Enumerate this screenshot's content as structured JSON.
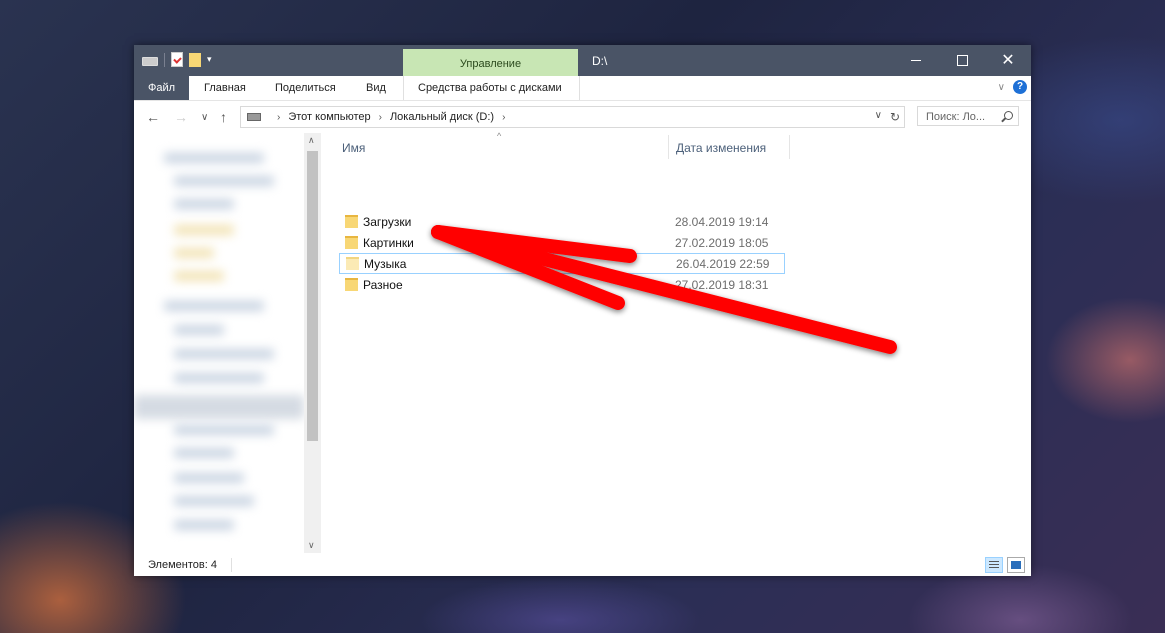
{
  "titlebar": {
    "manage_tab": "Управление",
    "path_title": "D:\\"
  },
  "ribbon": {
    "tabs": [
      {
        "label": "Файл"
      },
      {
        "label": "Главная"
      },
      {
        "label": "Поделиться"
      },
      {
        "label": "Вид"
      },
      {
        "label": "Средства работы с дисками"
      }
    ],
    "help_label": "?"
  },
  "address": {
    "crumbs": [
      "Этот компьютер",
      "Локальный диск (D:)"
    ],
    "search_placeholder": "Поиск: Ло..."
  },
  "columns": {
    "name": "Имя",
    "date": "Дата изменения"
  },
  "files": [
    {
      "name": "Загрузки",
      "date": "28.04.2019 19:14"
    },
    {
      "name": "Картинки",
      "date": "27.02.2019 18:05"
    },
    {
      "name": "Музыка",
      "date": "26.04.2019 22:59",
      "selected": true
    },
    {
      "name": "Разное",
      "date": "27.02.2019 18:31"
    }
  ],
  "status": {
    "items_count": "Элементов: 4"
  },
  "colors": {
    "titlebar": "#4a5466",
    "manage_tab": "#c8e6b4",
    "folder": "#f8d775",
    "annotation_arrow": "#ff0000"
  }
}
